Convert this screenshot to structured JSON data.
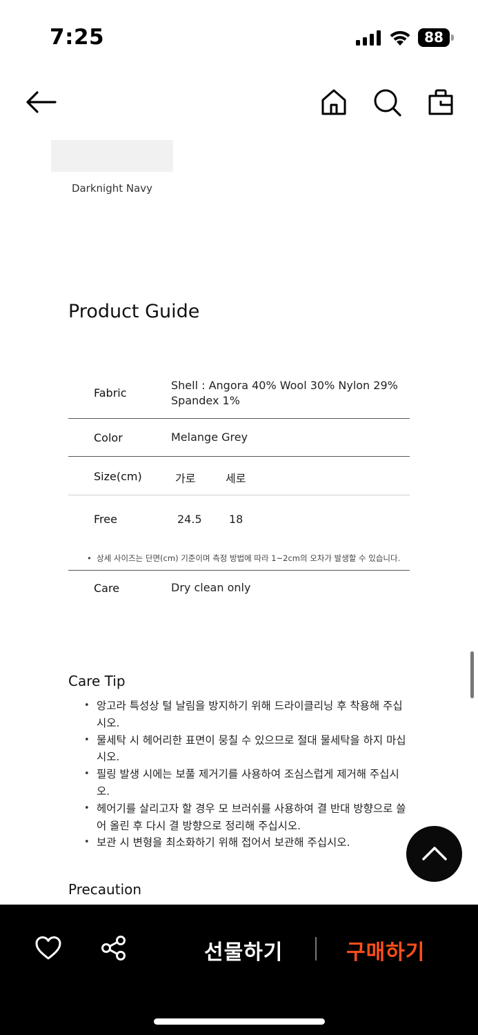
{
  "status_bar": {
    "time": "7:25",
    "battery": "88"
  },
  "nav": {
    "back_icon": "arrow-left-icon",
    "home_icon": "home-icon",
    "search_icon": "search-icon",
    "bag_icon": "shopping-bag-icon"
  },
  "swatch": {
    "label": "Darknight Navy",
    "color": "#f1f1f1"
  },
  "product_guide": {
    "title": "Product Guide",
    "fabric_label": "Fabric",
    "fabric_value_line1": "Shell : Angora 40% Wool 30% Nylon 29%",
    "fabric_value_line2": "Spandex 1%",
    "color_label": "Color",
    "color_value": "Melange Grey",
    "size_label": "Size(cm)",
    "size_col_width": "가로",
    "size_col_height": "세로",
    "free_label": "Free",
    "free_width": "24.5",
    "free_height": "18",
    "size_note": "상세 사이즈는 단면(cm) 기준이며 측정 방법에 따라 1~2cm의 오차가 발생할 수 있습니다.",
    "care_label": "Care",
    "care_value": "Dry clean only"
  },
  "care_tip": {
    "title": "Care Tip",
    "items": [
      "앙고라 특성상 털 날림을 방지하기 위해 드라이클리닝 후 착용해 주십시오.",
      "물세탁 시 헤어리한 표면이 뭉칠 수 있으므로 절대 물세탁을 하지 마십시오.",
      "필링 발생 시에는 보풀 제거기를 사용하여 조심스럽게 제거해 주십시오.",
      "헤어기를 살리고자 할 경우 모 브러쉬를 사용하여 결 반대 방향으로 쓸어 올린 후 다시 결 방향으로 정리해 주십시오.",
      "보관 시 변형을 최소화하기 위해 접어서 보관해 주십시오."
    ]
  },
  "precaution": {
    "title": "Precaution"
  },
  "bottom_bar": {
    "gift_label": "선물하기",
    "buy_label": "구매하기",
    "buy_color": "#ff4f1a",
    "wishlist_icon": "heart-icon",
    "share_icon": "share-icon"
  },
  "scroll_top_icon": "chevron-up-icon"
}
